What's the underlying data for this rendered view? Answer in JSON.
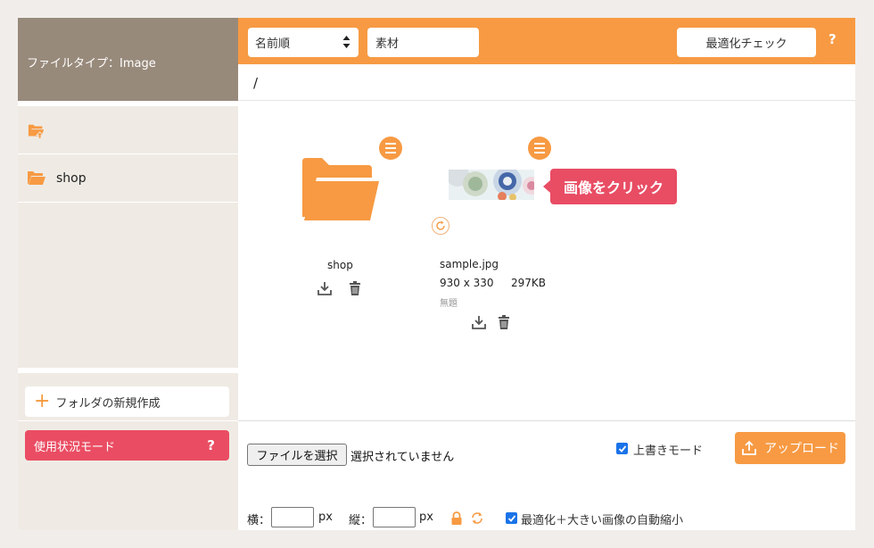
{
  "sidebar": {
    "file_type_label": "ファイルタイプ：Image",
    "items": [
      {
        "label": "",
        "icon": "folder-up-icon"
      },
      {
        "label": "shop",
        "icon": "folder-open-icon"
      }
    ],
    "new_folder_label": "フォルダの新規作成",
    "usage_mode_label": "使用状況モード",
    "usage_help": "?"
  },
  "toolbar": {
    "sort_value": "名前順",
    "keyword_value": "素材",
    "optimize_check_label": "最適化チェック",
    "help": "?"
  },
  "path": "/",
  "files": [
    {
      "name": "shop",
      "type": "folder"
    },
    {
      "name": "sample.jpg",
      "type": "image",
      "dimensions": "930 x 330",
      "size": "297KB",
      "title": "無題"
    }
  ],
  "tooltip": "画像をクリック",
  "footer": {
    "choose_file_label": "ファイルを選択",
    "no_file_text": "選択されていません",
    "overwrite_label": "上書きモード",
    "overwrite_checked": true,
    "upload_label": "アップロード",
    "width_label": "横：",
    "height_label": "縦：",
    "px": "px",
    "auto_resize_label": "最適化＋大きい画像の自動縮小",
    "auto_resize_checked": true
  },
  "colors": {
    "accent": "#f79a43",
    "danger": "#ea4d63",
    "sidebar_header": "#988a7b",
    "sidebar_bg": "#efebe4",
    "checkbox": "#1a73e8"
  }
}
